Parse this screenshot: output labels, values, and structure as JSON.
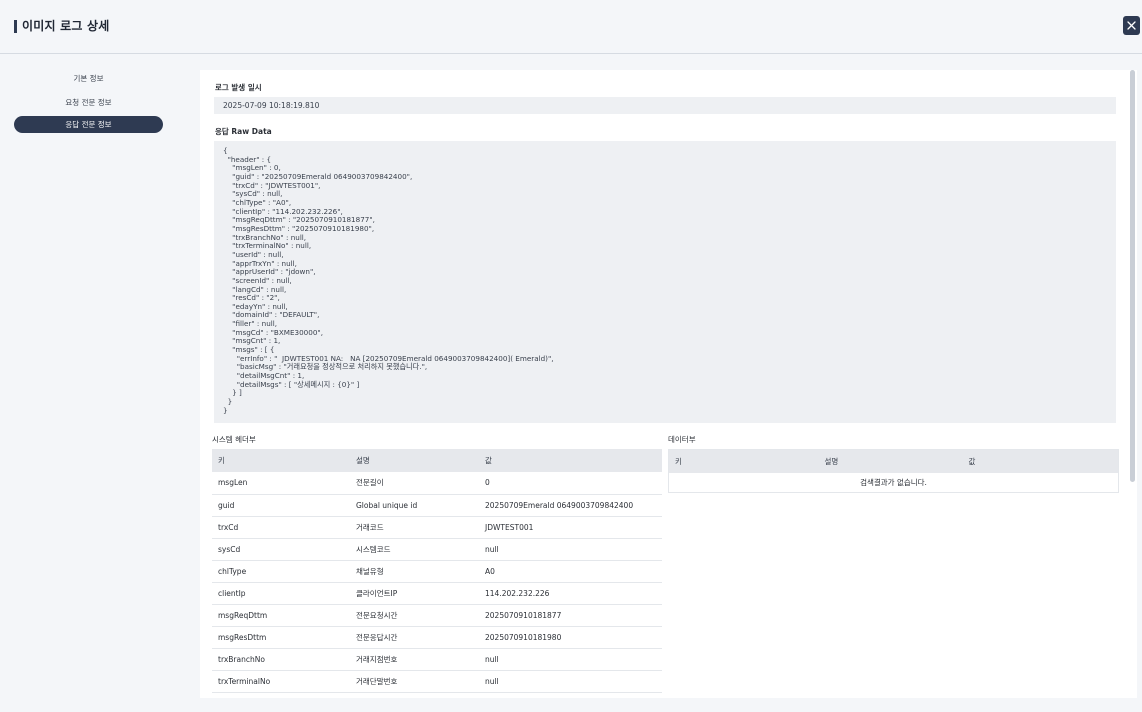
{
  "header": {
    "title": "이미지 로그 상세",
    "close_icon": "close-icon"
  },
  "sidebar": {
    "items": [
      {
        "label": "기본 정보",
        "active": false
      },
      {
        "label": "요청 전문 정보",
        "active": false
      },
      {
        "label": "응답 전문 정보",
        "active": true
      }
    ]
  },
  "main": {
    "log_time_label": "로그 발생 일시",
    "log_time_value": "2025-07-09 10:18:19.810",
    "raw_label": "응답 Raw Data",
    "raw_data": "{\n  \"header\" : {\n    \"msgLen\" : 0,\n    \"guid\" : \"20250709Emerald 0649003709842400\",\n    \"trxCd\" : \"JDWTEST001\",\n    \"sysCd\" : null,\n    \"chlType\" : \"A0\",\n    \"clientIp\" : \"114.202.232.226\",\n    \"msgReqDttm\" : \"2025070910181877\",\n    \"msgResDttm\" : \"2025070910181980\",\n    \"trxBranchNo\" : null,\n    \"trxTerminalNo\" : null,\n    \"userId\" : null,\n    \"apprTrxYn\" : null,\n    \"apprUserId\" : \"jdown\",\n    \"screenId\" : null,\n    \"langCd\" : null,\n    \"resCd\" : \"2\",\n    \"edayYn\" : null,\n    \"domainId\" : \"DEFAULT\",\n    \"filler\" : null,\n    \"msgCd\" : \"BXME30000\",\n    \"msgCnt\" : 1,\n    \"msgs\" : [ {\n      \"errInfo\" : \"  JDWTEST001 NA:   NA [20250709Emerald 0649003709842400]( Emerald)\",\n      \"basicMsg\" : \"거래요청을 정상적으로 처리하지 못했습니다.\",\n      \"detailMsgCnt\" : 1,\n      \"detailMsgs\" : [ \"상세메시지 : {0}\" ]\n    } ]\n  }\n}",
    "system_header_label": "시스템 헤더부",
    "data_section_label": "데이터부",
    "columns": [
      "키",
      "설명",
      "값"
    ],
    "system_rows": [
      {
        "key": "msgLen",
        "desc": "전문길이",
        "value": "0"
      },
      {
        "key": "guid",
        "desc": "Global unique id",
        "value": "20250709Emerald 0649003709842400"
      },
      {
        "key": "trxCd",
        "desc": "거래코드",
        "value": "JDWTEST001"
      },
      {
        "key": "sysCd",
        "desc": "시스템코드",
        "value": "null"
      },
      {
        "key": "chlType",
        "desc": "채널유형",
        "value": "A0"
      },
      {
        "key": "clientIp",
        "desc": "클라이언트IP",
        "value": "114.202.232.226"
      },
      {
        "key": "msgReqDttm",
        "desc": "전문요청시간",
        "value": "2025070910181877"
      },
      {
        "key": "msgResDttm",
        "desc": "전문응답시간",
        "value": "2025070910181980"
      },
      {
        "key": "trxBranchNo",
        "desc": "거래지점번호",
        "value": "null"
      },
      {
        "key": "trxTerminalNo",
        "desc": "거래단말번호",
        "value": "null"
      }
    ],
    "data_empty_message": "검색결과가 없습니다."
  },
  "colors": {
    "accent": "#2e3a52",
    "background": "#f4f6f9",
    "panel": "#ffffff",
    "table_header": "#e6e8ec"
  }
}
